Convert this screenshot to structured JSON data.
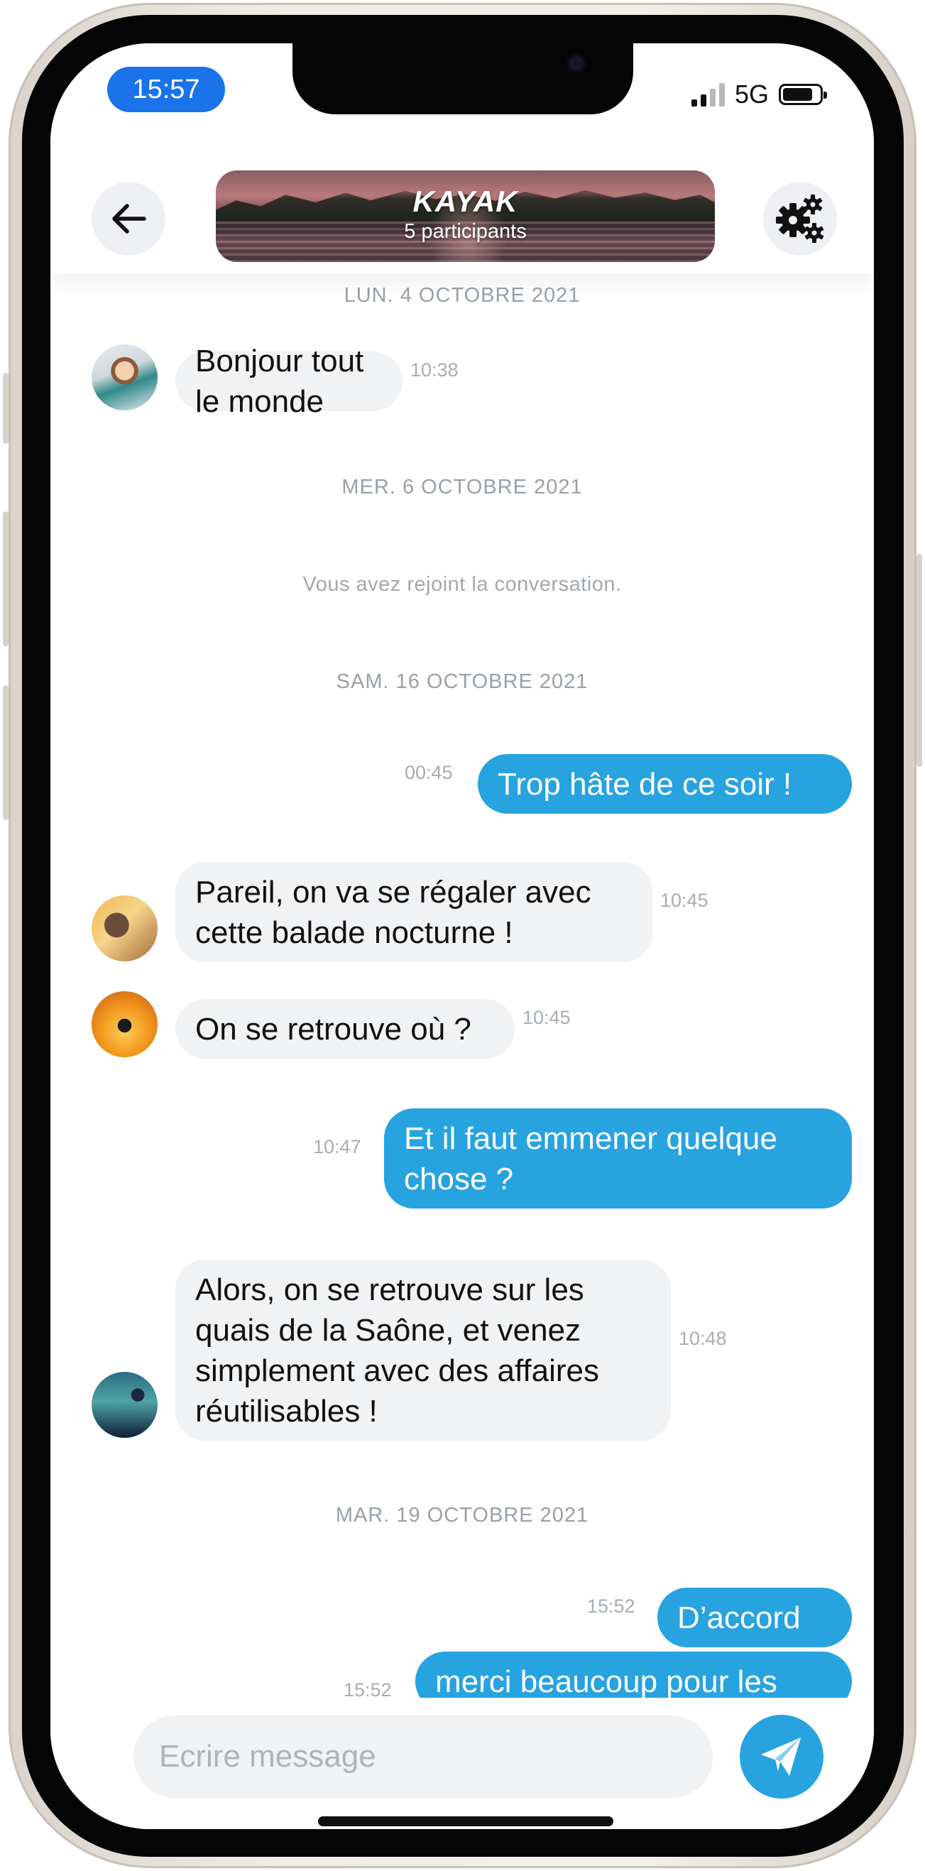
{
  "status_bar": {
    "time": "15:57",
    "network": "5G",
    "signal_bars_active": 2,
    "signal_bars_total": 4
  },
  "header": {
    "back_icon": "arrow-left-icon",
    "settings_icon": "gears-icon",
    "group_name": "KAYAK",
    "participants": "5 participants"
  },
  "messages": [
    {
      "kind": "date",
      "text": "LUN. 4 OCTOBRE 2021"
    },
    {
      "kind": "in",
      "text": "Bonjour tout le monde",
      "time": "10:38"
    },
    {
      "kind": "date",
      "text": "MER. 6 OCTOBRE 2021"
    },
    {
      "kind": "system",
      "text": "Vous avez rejoint la conversation."
    },
    {
      "kind": "date",
      "text": "SAM. 16 OCTOBRE 2021"
    },
    {
      "kind": "out",
      "text": "Trop hâte de ce soir !",
      "time": "00:45"
    },
    {
      "kind": "in",
      "text": "Pareil, on va se régaler avec\ncette balade nocturne !",
      "time": "10:45"
    },
    {
      "kind": "in",
      "text": "On se retrouve où ?",
      "time": "10:45"
    },
    {
      "kind": "out",
      "text": "Et il faut emmener quelque\nchose ?",
      "time": "10:47"
    },
    {
      "kind": "in",
      "text": "Alors, on se retrouve sur les\nquais de la Saône, et venez\nsimplement avec des affaires\nréutilisables !",
      "time": "10:48"
    },
    {
      "kind": "date",
      "text": "MAR. 19 OCTOBRE 2021"
    },
    {
      "kind": "out",
      "text": "D’accord",
      "time": "15:52"
    },
    {
      "kind": "out",
      "text": "merci beaucoup pour les",
      "time": "15:52"
    }
  ],
  "composer": {
    "placeholder": "Ecrire message",
    "send_icon": "paper-plane-icon"
  },
  "colors": {
    "accent": "#27a3e0",
    "time_pill": "#1a73e8",
    "incoming_bubble": "#f1f2f4",
    "meta_text": "#a7adb3"
  }
}
